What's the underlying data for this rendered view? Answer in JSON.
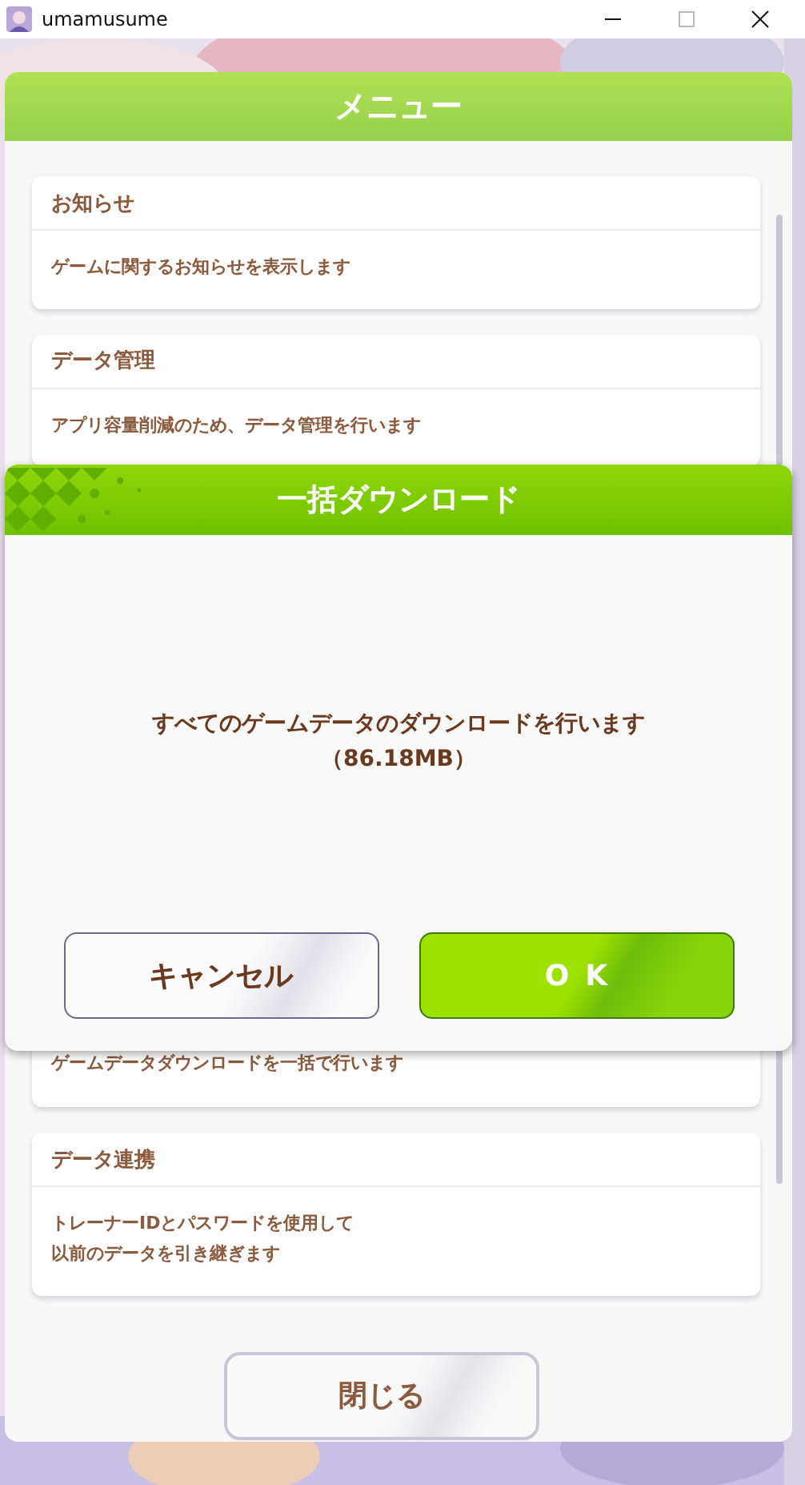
{
  "window": {
    "title": "umamusume"
  },
  "menu": {
    "title": "メニュー",
    "items": [
      {
        "title": "お知らせ",
        "description": "ゲームに関するお知らせを表示します"
      },
      {
        "title": "データ管理",
        "description": "アプリ容量削減のため、データ管理を行います"
      },
      {
        "description": "ゲームデータダウンロードを一括で行います"
      },
      {
        "title": "データ連携",
        "description_lines": [
          "トレーナーIDとパスワードを使用して",
          "以前のデータを引き継ぎます"
        ]
      }
    ],
    "close_button": "閉じる"
  },
  "dialog": {
    "title": "一括ダウンロード",
    "message": "すべてのゲームデータのダウンロードを行います",
    "size": "（86.18MB）",
    "buttons": [
      {
        "label": "キャンセル",
        "kind": "secondary"
      },
      {
        "label": "OK",
        "kind": "primary"
      }
    ]
  }
}
